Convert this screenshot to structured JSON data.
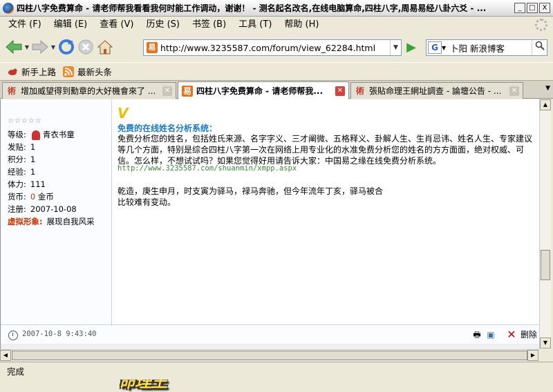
{
  "window": {
    "title": "四柱八字免费算命 - 请老师帮我看看我何时能工作调动，谢谢！ - 测名起名改名,在线电脑算命,四柱八字,周易易经八卦六爻 - ...",
    "buttons": {
      "minimize": "_",
      "maximize": "□",
      "close": "X"
    }
  },
  "menu": {
    "items": [
      "文件 (F)",
      "编辑 (E)",
      "查看 (V)",
      "历史 (S)",
      "书签 (B)",
      "工具 (T)",
      "帮助 (H)"
    ]
  },
  "navigation": {
    "url": "http://www.3235587.com/forum/view_62284.html",
    "search_engine": "G",
    "search_text": "卜阳 新浪博客",
    "icons": [
      "back-icon",
      "forward-icon",
      "reload-icon",
      "stop-icon",
      "home-icon",
      "go-icon",
      "search-icon"
    ]
  },
  "bookmarks": {
    "items": [
      {
        "label": "新手上路",
        "icon": "bird-icon"
      },
      {
        "label": "最新头条",
        "icon": "rss-icon"
      }
    ]
  },
  "tabs": [
    {
      "label": "增加威望得到勳章的大好機會來了 ...",
      "active": false
    },
    {
      "label": "四柱八字免费算命 - 请老师帮我...",
      "active": true
    },
    {
      "label": "張貼命理王網址調查 - 論壇公告 - ...",
      "active": false
    }
  ],
  "user": {
    "rank_stars": "☆☆☆☆☆",
    "rows": [
      {
        "key": "等级:",
        "value": "青衣书童"
      },
      {
        "key": "发贴:",
        "value": "1"
      },
      {
        "key": "积分:",
        "value": "1"
      },
      {
        "key": "经验:",
        "value": "1"
      },
      {
        "key": "体力:",
        "value": "111"
      },
      {
        "key": "货币:",
        "value_prefix": "0",
        "value": "金币"
      },
      {
        "key": "注册:",
        "value": "2007-10-08"
      },
      {
        "key": "虚拟形象:",
        "value": "展现自我风采"
      }
    ]
  },
  "post": {
    "title": "免费的在线姓名分析系统：",
    "body": "免费分析您的姓名，包括姓氏来源、名字字义、三才阐微、五格释义、卦解人生、生肖忌讳、姓名人生、专家建议等几个方面，特别是综合四柱八字第一次在网络上用专业化的水准免费分析您的姓名的方方面面，绝对权威、可信。怎么样，不想试试吗？如果您觉得好用请告诉大家：中国易之缘在线免费分析系统。",
    "link": "http://www.3235587.com/shuanmin/xmpp.aspx",
    "line1": "乾造，庚生申月，时支寅为驿马，禄马奔驰，但今年流年丁亥，驿马被合",
    "line2": "比较难有变动。",
    "logo_text": "命理王",
    "time": "2007-10-8 9:43:40",
    "delete_label": "删除"
  },
  "status": {
    "text": "完成"
  }
}
